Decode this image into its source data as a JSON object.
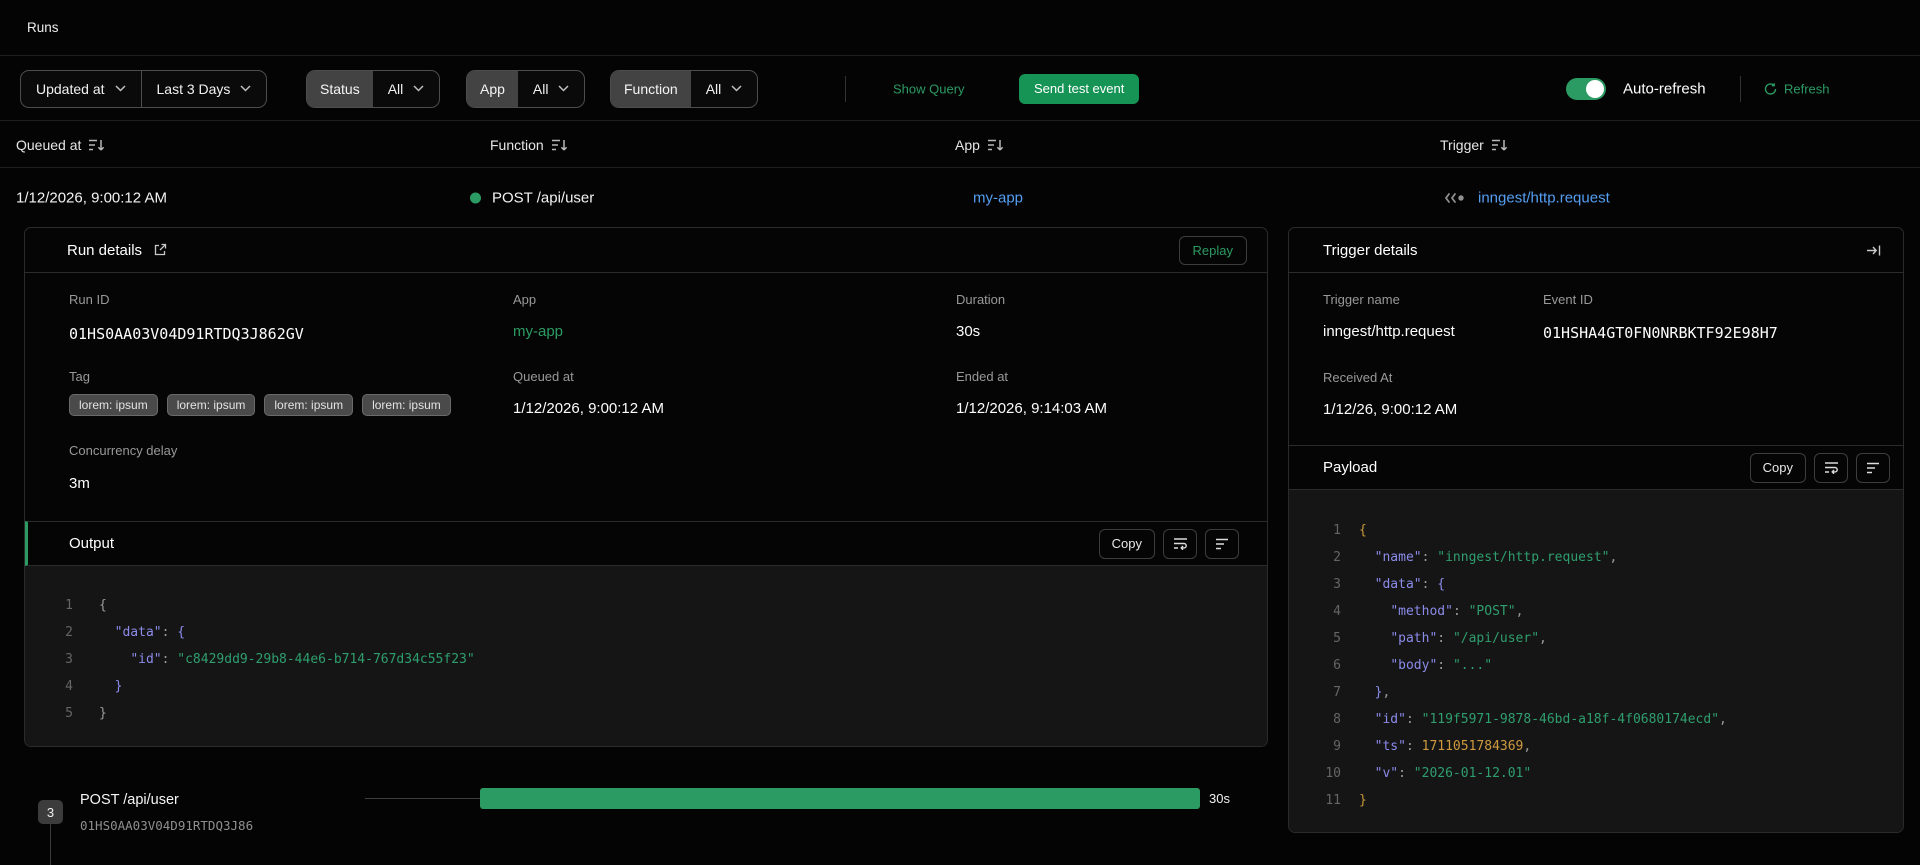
{
  "page": {
    "title": "Runs"
  },
  "filterbar": {
    "sort_field": "Updated at",
    "time_range": "Last 3 Days",
    "status": {
      "label": "Status",
      "value": "All"
    },
    "app": {
      "label": "App",
      "value": "All"
    },
    "function": {
      "label": "Function",
      "value": "All"
    },
    "show_query": "Show Query",
    "send_test_event": "Send test event",
    "auto_refresh_label": "Auto-refresh",
    "refresh_label": "Refresh"
  },
  "table": {
    "headers": {
      "queued_at": "Queued at",
      "function": "Function",
      "app": "App",
      "trigger": "Trigger"
    },
    "row": {
      "queued_at": "1/12/2026, 9:00:12 AM",
      "function_name": "POST /api/user",
      "app": "my-app",
      "trigger": "inngest/http.request"
    }
  },
  "run_details": {
    "title": "Run details",
    "replay_label": "Replay",
    "run_id": {
      "label": "Run ID",
      "value": "01HS0AA03V04D91RTDQ3J862GV"
    },
    "app": {
      "label": "App",
      "value": "my-app"
    },
    "duration": {
      "label": "Duration",
      "value": "30s"
    },
    "tag": {
      "label": "Tag",
      "chips": [
        "lorem: ipsum",
        "lorem: ipsum",
        "lorem: ipsum",
        "lorem: ipsum"
      ]
    },
    "queued_at": {
      "label": "Queued at",
      "value": "1/12/2026, 9:00:12 AM"
    },
    "ended_at": {
      "label": "Ended at",
      "value": "1/12/2026, 9:14:03 AM"
    },
    "concurrency_delay": {
      "label": "Concurrency delay",
      "value": "3m"
    },
    "output": {
      "title": "Output",
      "copy_label": "Copy",
      "lines": [
        [
          [
            "p",
            "{"
          ]
        ],
        [
          [
            "p",
            "  "
          ],
          [
            "k",
            "\"data\""
          ],
          [
            "p",
            ": "
          ],
          [
            "b2",
            "{"
          ]
        ],
        [
          [
            "p",
            "    "
          ],
          [
            "k",
            "\"id\""
          ],
          [
            "p",
            ": "
          ],
          [
            "s",
            "\"c8429dd9-29b8-44e6-b714-767d34c55f23\""
          ]
        ],
        [
          [
            "p",
            "  "
          ],
          [
            "b2",
            "}"
          ]
        ],
        [
          [
            "p",
            "}"
          ]
        ]
      ]
    }
  },
  "trigger_details": {
    "title": "Trigger details",
    "trigger_name": {
      "label": "Trigger name",
      "value": "inngest/http.request"
    },
    "event_id": {
      "label": "Event ID",
      "value": "01HSHA4GT0FN0NRBKTF92E98H7"
    },
    "received_at": {
      "label": "Received At",
      "value": "1/12/26, 9:00:12 AM"
    },
    "payload": {
      "title": "Payload",
      "copy_label": "Copy",
      "lines": [
        [
          [
            "b1",
            "{"
          ]
        ],
        [
          [
            "p",
            "  "
          ],
          [
            "k",
            "\"name\""
          ],
          [
            "p",
            ": "
          ],
          [
            "s",
            "\"inngest/http.request\""
          ],
          [
            "p",
            ","
          ]
        ],
        [
          [
            "p",
            "  "
          ],
          [
            "k",
            "\"data\""
          ],
          [
            "p",
            ": "
          ],
          [
            "b2",
            "{"
          ]
        ],
        [
          [
            "p",
            "    "
          ],
          [
            "k",
            "\"method\""
          ],
          [
            "p",
            ": "
          ],
          [
            "s",
            "\"POST\""
          ],
          [
            "p",
            ","
          ]
        ],
        [
          [
            "p",
            "    "
          ],
          [
            "k",
            "\"path\""
          ],
          [
            "p",
            ": "
          ],
          [
            "s",
            "\"/api/user\""
          ],
          [
            "p",
            ","
          ]
        ],
        [
          [
            "p",
            "    "
          ],
          [
            "k",
            "\"body\""
          ],
          [
            "p",
            ": "
          ],
          [
            "s",
            "\"...\""
          ]
        ],
        [
          [
            "p",
            "  "
          ],
          [
            "b2",
            "}"
          ],
          [
            "p",
            ","
          ]
        ],
        [
          [
            "p",
            "  "
          ],
          [
            "k",
            "\"id\""
          ],
          [
            "p",
            ": "
          ],
          [
            "s",
            "\"119f5971-9878-46bd-a18f-4f0680174ecd\""
          ],
          [
            "p",
            ","
          ]
        ],
        [
          [
            "p",
            "  "
          ],
          [
            "k",
            "\"ts\""
          ],
          [
            "p",
            ": "
          ],
          [
            "n",
            "1711051784369"
          ],
          [
            "p",
            ","
          ]
        ],
        [
          [
            "p",
            "  "
          ],
          [
            "k",
            "\"v\""
          ],
          [
            "p",
            ": "
          ],
          [
            "s",
            "\"2026-01-12.01\""
          ]
        ],
        [
          [
            "b1",
            "}"
          ]
        ]
      ]
    }
  },
  "timeline": {
    "step_count": "3",
    "step_name": "POST /api/user",
    "run_id": "01HS0AA03V04D91RTDQ3J86",
    "duration": "30s"
  },
  "colors": {
    "accent_green": "#2c9b63",
    "button_green": "#169455",
    "link_blue": "#549ef2",
    "code_key": "#8b8bea",
    "code_string": "#2f9e6e",
    "code_number": "#cf9a3f",
    "status_dot_green": "#2c9b63"
  }
}
